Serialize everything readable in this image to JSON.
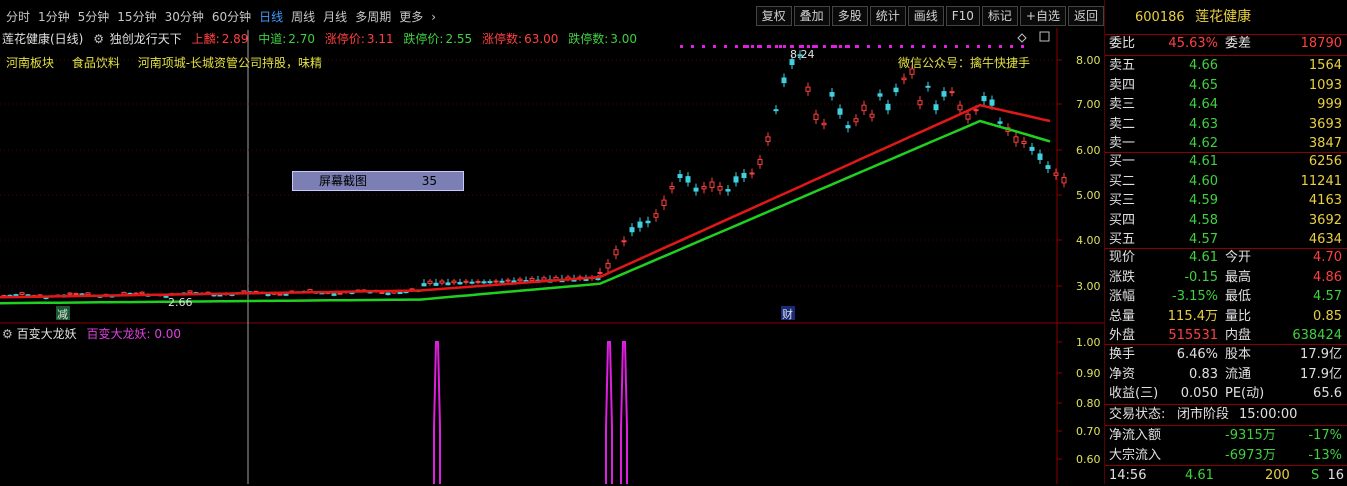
{
  "periods": [
    "分时",
    "1分钟",
    "5分钟",
    "15分钟",
    "30分钟",
    "60分钟",
    "日线",
    "周线",
    "月线",
    "多周期",
    "更多"
  ],
  "active_period": "日线",
  "tools": [
    "复权",
    "叠加",
    "多股",
    "统计",
    "画线",
    "F10",
    "标记",
    "+自选",
    "返回"
  ],
  "title": {
    "stock": "莲花健康(日线)",
    "indicator": "独创龙行天下",
    "upper_label": "上麟:",
    "upper_value": "2.89",
    "mid_label": "中道:",
    "mid_value": "2.70",
    "limit_up_price_label": "涨停价:",
    "limit_up_price": "3.11",
    "limit_down_price_label": "跌停价:",
    "limit_down_price": "2.55",
    "limit_up_count_label": "涨停数:",
    "limit_up_count": "63.00",
    "limit_down_count_label": "跌停数:",
    "limit_down_count": "3.00"
  },
  "info": [
    "河南板块",
    "食品饮料",
    "河南项城-长城资管公司持股，味精"
  ],
  "wechat": "微信公众号：擒牛快捷手",
  "screenshot_box": {
    "label": "屏幕截图",
    "value": "35"
  },
  "price_axis": [
    "8.00",
    "7.00",
    "6.00",
    "5.00",
    "4.00",
    "3.00"
  ],
  "price_marks": {
    "high": "8.24",
    "low": "2.66",
    "reduce_tag": "减",
    "fin_tag": "财"
  },
  "sub_title": {
    "name": "百变大龙妖",
    "value_label": "百变大龙妖:",
    "value": "0.00"
  },
  "sub_axis": [
    "1.00",
    "0.90",
    "0.80",
    "0.70",
    "0.60"
  ],
  "colors": {
    "up": "#ff4040",
    "down": "#3fd23f",
    "ma_red": "#e01818",
    "ma_green": "#20d020",
    "signal": "#e020e0"
  },
  "quote": {
    "code": "600186",
    "name": "莲花健康",
    "weibi_label": "委比",
    "weibi": "45.63%",
    "weicha_label": "委差",
    "weicha": "18790",
    "asks": [
      {
        "label": "卖五",
        "price": "4.66",
        "vol": "1564"
      },
      {
        "label": "卖四",
        "price": "4.65",
        "vol": "1093"
      },
      {
        "label": "卖三",
        "price": "4.64",
        "vol": "999"
      },
      {
        "label": "卖二",
        "price": "4.63",
        "vol": "3693"
      },
      {
        "label": "卖一",
        "price": "4.62",
        "vol": "3847"
      }
    ],
    "bids": [
      {
        "label": "买一",
        "price": "4.61",
        "vol": "6256"
      },
      {
        "label": "买二",
        "price": "4.60",
        "vol": "11241"
      },
      {
        "label": "买三",
        "price": "4.59",
        "vol": "4163"
      },
      {
        "label": "买四",
        "price": "4.58",
        "vol": "3692"
      },
      {
        "label": "买五",
        "price": "4.57",
        "vol": "4634"
      }
    ],
    "stats": [
      {
        "l1": "现价",
        "v1": "4.61",
        "l2": "今开",
        "v2": "4.70"
      },
      {
        "l1": "涨跌",
        "v1": "-0.15",
        "l2": "最高",
        "v2": "4.86"
      },
      {
        "l1": "涨幅",
        "v1": "-3.15%",
        "l2": "最低",
        "v2": "4.57"
      },
      {
        "l1": "总量",
        "v1": "115.4万",
        "l2": "量比",
        "v2": "0.85"
      },
      {
        "l1": "外盘",
        "v1": "515531",
        "l2": "内盘",
        "v2": "638424"
      }
    ],
    "stats2": [
      {
        "l1": "换手",
        "v1": "6.46%",
        "l2": "股本",
        "v2": "17.9亿"
      },
      {
        "l1": "净资",
        "v1": "0.83",
        "l2": "流通",
        "v2": "17.9亿"
      },
      {
        "l1": "收益(三)",
        "v1": "0.050",
        "l2": "PE(动)",
        "v2": "65.6"
      }
    ],
    "trade_status_label": "交易状态:",
    "trade_status": "闭市阶段",
    "trade_time": "15:00:00",
    "flows": [
      {
        "label": "净流入额",
        "amount": "-9315万",
        "pct": "-17%"
      },
      {
        "label": "大宗流入",
        "amount": "-6973万",
        "pct": "-13%"
      }
    ],
    "tick": {
      "time": "14:56",
      "price": "4.61",
      "vol": "200",
      "side": "S",
      "count": "16"
    }
  }
}
